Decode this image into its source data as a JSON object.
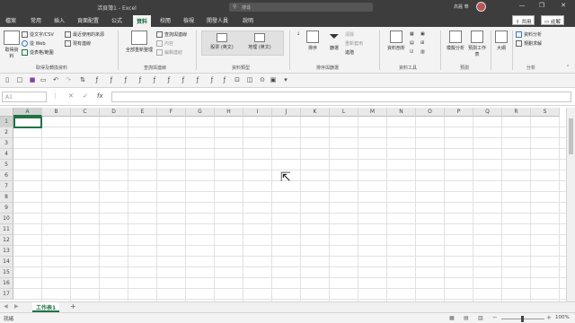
{
  "window": {
    "title": "活頁簿1 - Excel",
    "search_placeholder": "搜尋",
    "user_name": "高麗 華",
    "minimize": "—",
    "restore": "❐",
    "close": "✕"
  },
  "menu": {
    "tabs": [
      "檔案",
      "常用",
      "插入",
      "頁面配置",
      "公式",
      "資料",
      "校閱",
      "檢視",
      "開發人員",
      "說明"
    ],
    "active": "資料",
    "share": "共用",
    "comments": "註解"
  },
  "ribbon": {
    "get_data": {
      "big": "取得資料",
      "items": [
        "從文字/CSV",
        "從 Web",
        "從表格/範圍"
      ],
      "recent": [
        "最近使用的來源",
        "現有連線"
      ],
      "label": "取得及轉換資料"
    },
    "queries": {
      "big": "全部重新整理",
      "items": [
        "查詢與連線",
        "內容",
        "編輯連結"
      ],
      "label": "查詢與連線"
    },
    "types": {
      "stocks": "股票 (英文)",
      "geo": "地理 (英文)",
      "label": "資料類型"
    },
    "sort": {
      "sort": "排序",
      "filter": "篩選",
      "clear": "清除",
      "reapply": "重新套用",
      "advanced": "進階",
      "label": "排序與篩選"
    },
    "tools": {
      "text_to_cols": "資料剖析",
      "label": "資料工具"
    },
    "forecast": {
      "whatif": "模擬分析",
      "sheet": "預測工作表",
      "label": "預測"
    },
    "outline": {
      "outline": "大綱"
    },
    "analysis": {
      "data_analysis": "資料分析",
      "solver": "規劃求解",
      "label": "分析"
    }
  },
  "formula_bar": {
    "name_box": "A1",
    "fx": "fx",
    "cancel": "✕",
    "enter": "✓",
    "value": ""
  },
  "grid": {
    "columns": [
      "A",
      "B",
      "C",
      "D",
      "E",
      "F",
      "G",
      "H",
      "I",
      "J",
      "K",
      "L",
      "M",
      "N",
      "O",
      "P",
      "Q",
      "R",
      "S"
    ],
    "rows": [
      "1",
      "2",
      "3",
      "4",
      "5",
      "6",
      "7",
      "8",
      "9",
      "10",
      "11",
      "12",
      "13",
      "14",
      "15",
      "16",
      "17"
    ],
    "selected_cell": "A1"
  },
  "sheets": {
    "tabs": [
      "工作表1"
    ],
    "add": "+"
  },
  "status": {
    "ready": "就緒",
    "zoom": "100%"
  }
}
